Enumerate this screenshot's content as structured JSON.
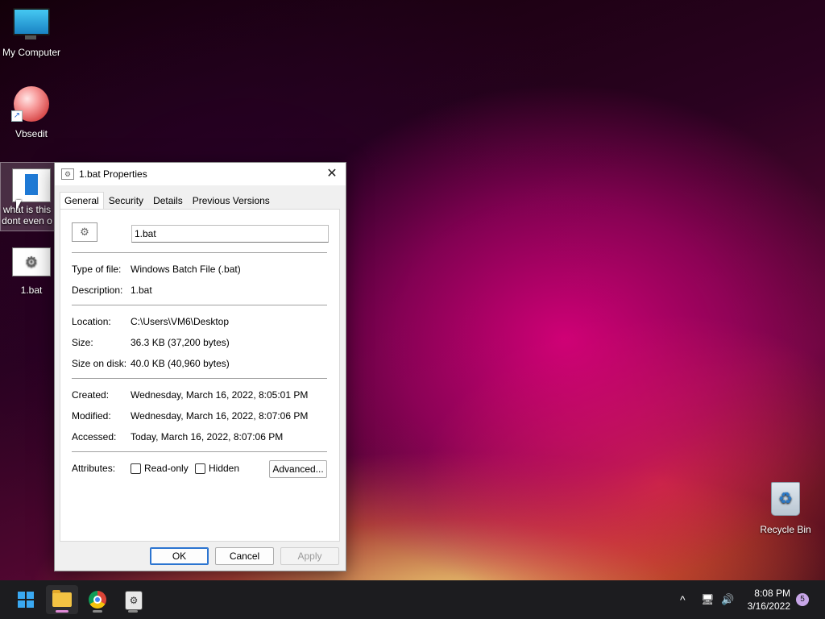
{
  "desktop": {
    "icons": [
      {
        "label": "My Computer"
      },
      {
        "label": "Vbsedit"
      },
      {
        "label": "what is this\ndont even o"
      },
      {
        "label": "1.bat"
      },
      {
        "label": "Recycle Bin"
      }
    ]
  },
  "dialog": {
    "title": "1.bat Properties",
    "close": "✕",
    "tabs": [
      "General",
      "Security",
      "Details",
      "Previous Versions"
    ],
    "active_tab": "General",
    "filename": "1.bat",
    "fields": {
      "type_label": "Type of file:",
      "type_value": "Windows Batch File (.bat)",
      "desc_label": "Description:",
      "desc_value": "1.bat",
      "location_label": "Location:",
      "location_value": "C:\\Users\\VM6\\Desktop",
      "size_label": "Size:",
      "size_value": "36.3 KB (37,200 bytes)",
      "sizedisk_label": "Size on disk:",
      "sizedisk_value": "40.0 KB (40,960 bytes)",
      "created_label": "Created:",
      "created_value": "Wednesday, March 16, 2022, 8:05:01 PM",
      "modified_label": "Modified:",
      "modified_value": "Wednesday, March 16, 2022, 8:07:06 PM",
      "accessed_label": "Accessed:",
      "accessed_value": "Today, March 16, 2022, 8:07:06 PM",
      "attributes_label": "Attributes:"
    },
    "attributes": {
      "readonly_label": "Read-only",
      "readonly_checked": false,
      "hidden_label": "Hidden",
      "hidden_checked": false,
      "advanced_label": "Advanced..."
    },
    "buttons": {
      "ok": "OK",
      "cancel": "Cancel",
      "apply": "Apply"
    }
  },
  "taskbar": {
    "apps": [
      "start-icon",
      "file-explorer-icon",
      "chrome-icon",
      "app-icon"
    ],
    "tray": {
      "chevron": "^",
      "network": "🖥",
      "volume": "🔊"
    },
    "time": "8:08 PM",
    "date": "3/16/2022",
    "notification_count": "5"
  },
  "colors": {
    "accent": "#2b74d0",
    "taskbar": "#1c1c1f",
    "active_indicator": "#e08ad8"
  }
}
